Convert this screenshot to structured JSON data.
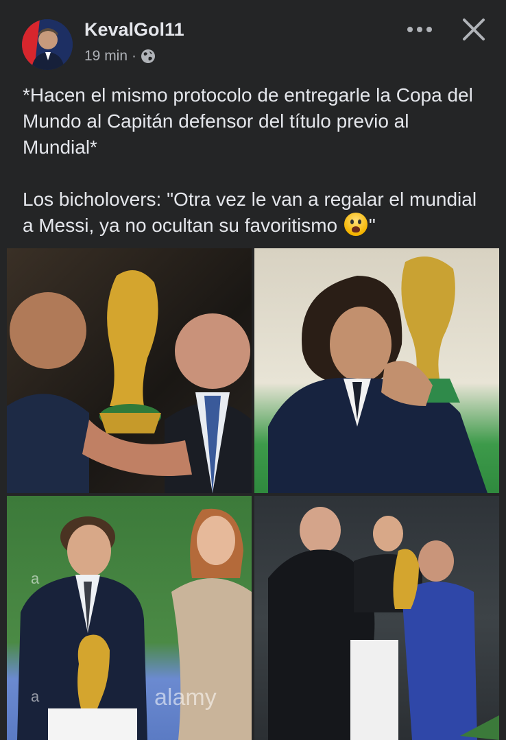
{
  "post": {
    "author": "KevalGol11",
    "time": "19 min",
    "separator": "·",
    "text_line_1": "*Hacen el mismo protocolo de entregarle la Copa del Mundo al Capitán defensor del título previo al Mundial*",
    "text_line_2": "Los bicholovers: \"Otra vez le van a regalar el mundial a Messi, ya no ocultan su favoritismo ",
    "text_line_2_end": "\"",
    "emoji": "crying-face-emoji"
  },
  "icons": {
    "privacy": "globe-icon",
    "more": "more-horizontal-icon",
    "close": "close-icon"
  },
  "photos": {
    "watermark_alamy": "alamy",
    "watermark_a": "a"
  },
  "colors": {
    "background": "#242526",
    "text": "#e4e6eb",
    "secondary_text": "#b0b3b8"
  }
}
